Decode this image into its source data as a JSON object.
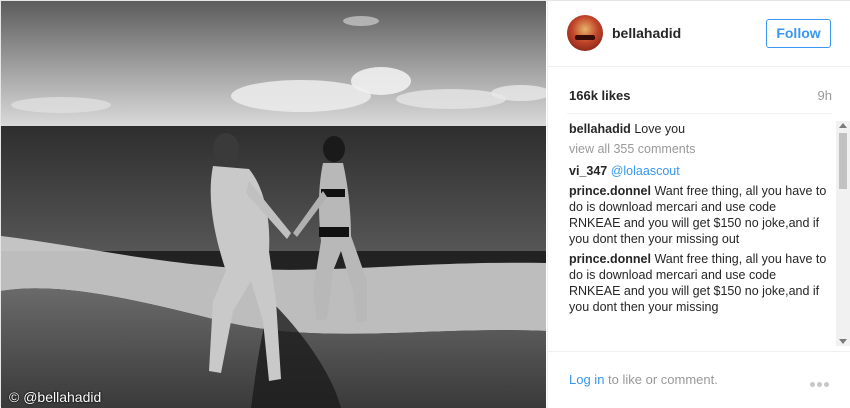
{
  "photo": {
    "credit": "© @bellahadid"
  },
  "header": {
    "username": "bellahadid",
    "follow_label": "Follow"
  },
  "stats": {
    "likes": "166k likes",
    "time": "9h"
  },
  "comments": {
    "first": {
      "author": "bellahadid",
      "text": "Love you"
    },
    "view_all": "view all 355 comments",
    "items": [
      {
        "author": "vi_347",
        "mention": "@lolaascout",
        "text": ""
      },
      {
        "author": "prince.donnel",
        "text": "Want free thing, all you have to do is download mercari and use code RNKEAE and you will get $150 no joke,and if you dont then your missing out"
      },
      {
        "author": "prince.donnel",
        "text": "Want free thing, all you have to do is download mercari and use code RNKEAE and you will get $150 no joke,and if you dont then your missing"
      }
    ]
  },
  "footer": {
    "login_link": "Log in",
    "login_suffix": " to like or comment."
  }
}
